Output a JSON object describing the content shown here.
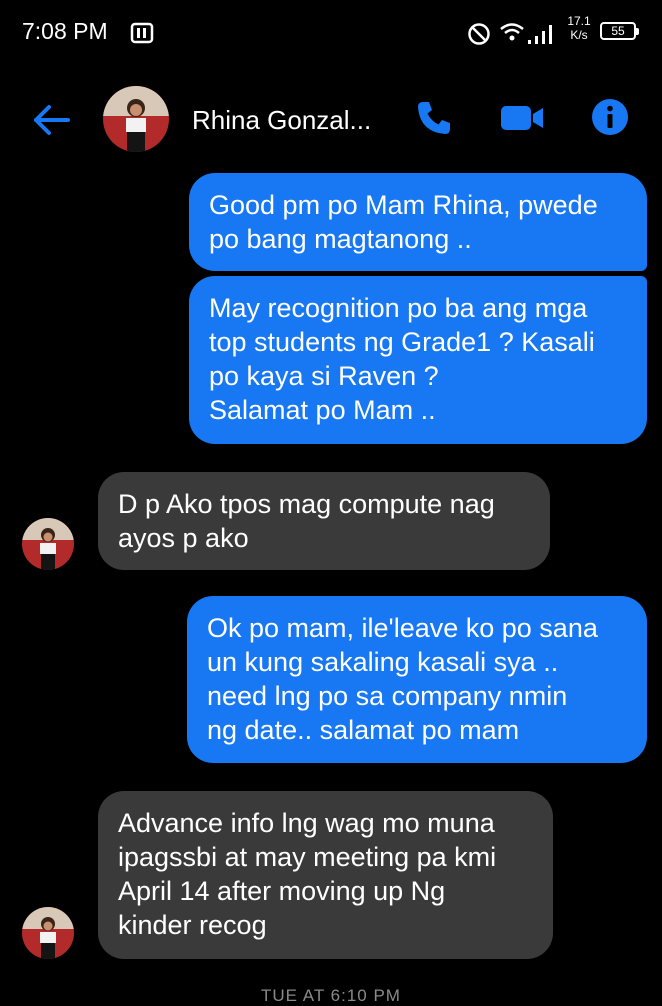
{
  "status_bar": {
    "time": "7:08 PM",
    "speed_value": "17.1",
    "speed_unit": "K/s",
    "battery": "55"
  },
  "header": {
    "contact_name": "Rhina Gonzal...",
    "icons": [
      "back-arrow-icon",
      "phone-icon",
      "video-camera-icon",
      "info-icon"
    ],
    "accent_color": "#1877f2"
  },
  "messages": [
    {
      "direction": "outgoing",
      "text": "Good pm po Mam Rhina, pwede\npo bang magtanong .."
    },
    {
      "direction": "outgoing",
      "text": "May recognition po ba ang mga\ntop students ng Grade1 ? Kasali\npo kaya si Raven ?\nSalamat po Mam .."
    },
    {
      "direction": "incoming",
      "text": "D p Ako tpos mag compute nag\nayos p ako"
    },
    {
      "direction": "outgoing",
      "text": "Ok po mam, ile'leave ko po sana\nun kung sakaling kasali sya ..\nneed lng po sa company nmin\nng date.. salamat po mam"
    },
    {
      "direction": "incoming",
      "text": "Advance info lng wag mo muna\nipagssbi at may meeting pa kmi\nApril 14 after moving up Ng\nkinder recog"
    }
  ],
  "timestamp": "TUE AT 6:10 PM"
}
